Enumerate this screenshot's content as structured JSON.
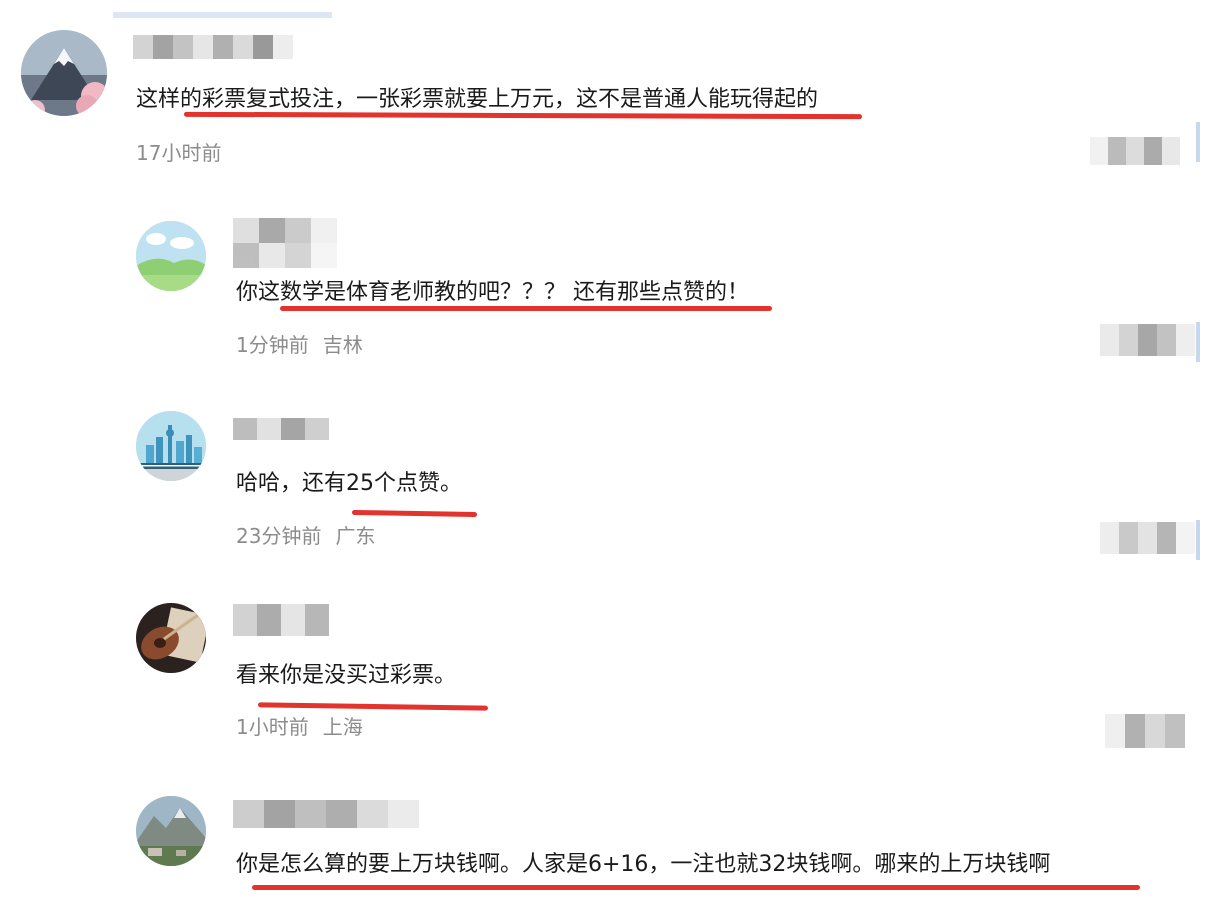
{
  "comments": [
    {
      "text": "这样的彩票复式投注，一张彩票就要上万元，这不是普通人能玩得起的",
      "time": "17小时前",
      "location": "",
      "avatar_icon": "mountain-sakura-avatar-icon"
    },
    {
      "text": "你这数学是体育老师教的吧？？？ 还有那些点赞的！",
      "time": "1分钟前",
      "location": "吉林",
      "avatar_icon": "meadow-avatar-icon"
    },
    {
      "text": "哈哈，还有25个点赞。",
      "time": "23分钟前",
      "location": "广东",
      "avatar_icon": "city-skyline-avatar-icon"
    },
    {
      "text": "看来你是没买过彩票。",
      "time": "1小时前",
      "location": "上海",
      "avatar_icon": "guitar-avatar-icon"
    },
    {
      "text": "你是怎么算的要上万块钱啊。人家是6+16，一注也就32块钱啊。哪来的上万块钱啊",
      "time": "",
      "location": "",
      "avatar_icon": "mountain-photo-avatar-icon"
    }
  ],
  "colors": {
    "text": "#1a1a1a",
    "meta": "#8c8c8c",
    "highlight_underline": "#e2332c",
    "scroll_accent": "#c5d8f0"
  }
}
